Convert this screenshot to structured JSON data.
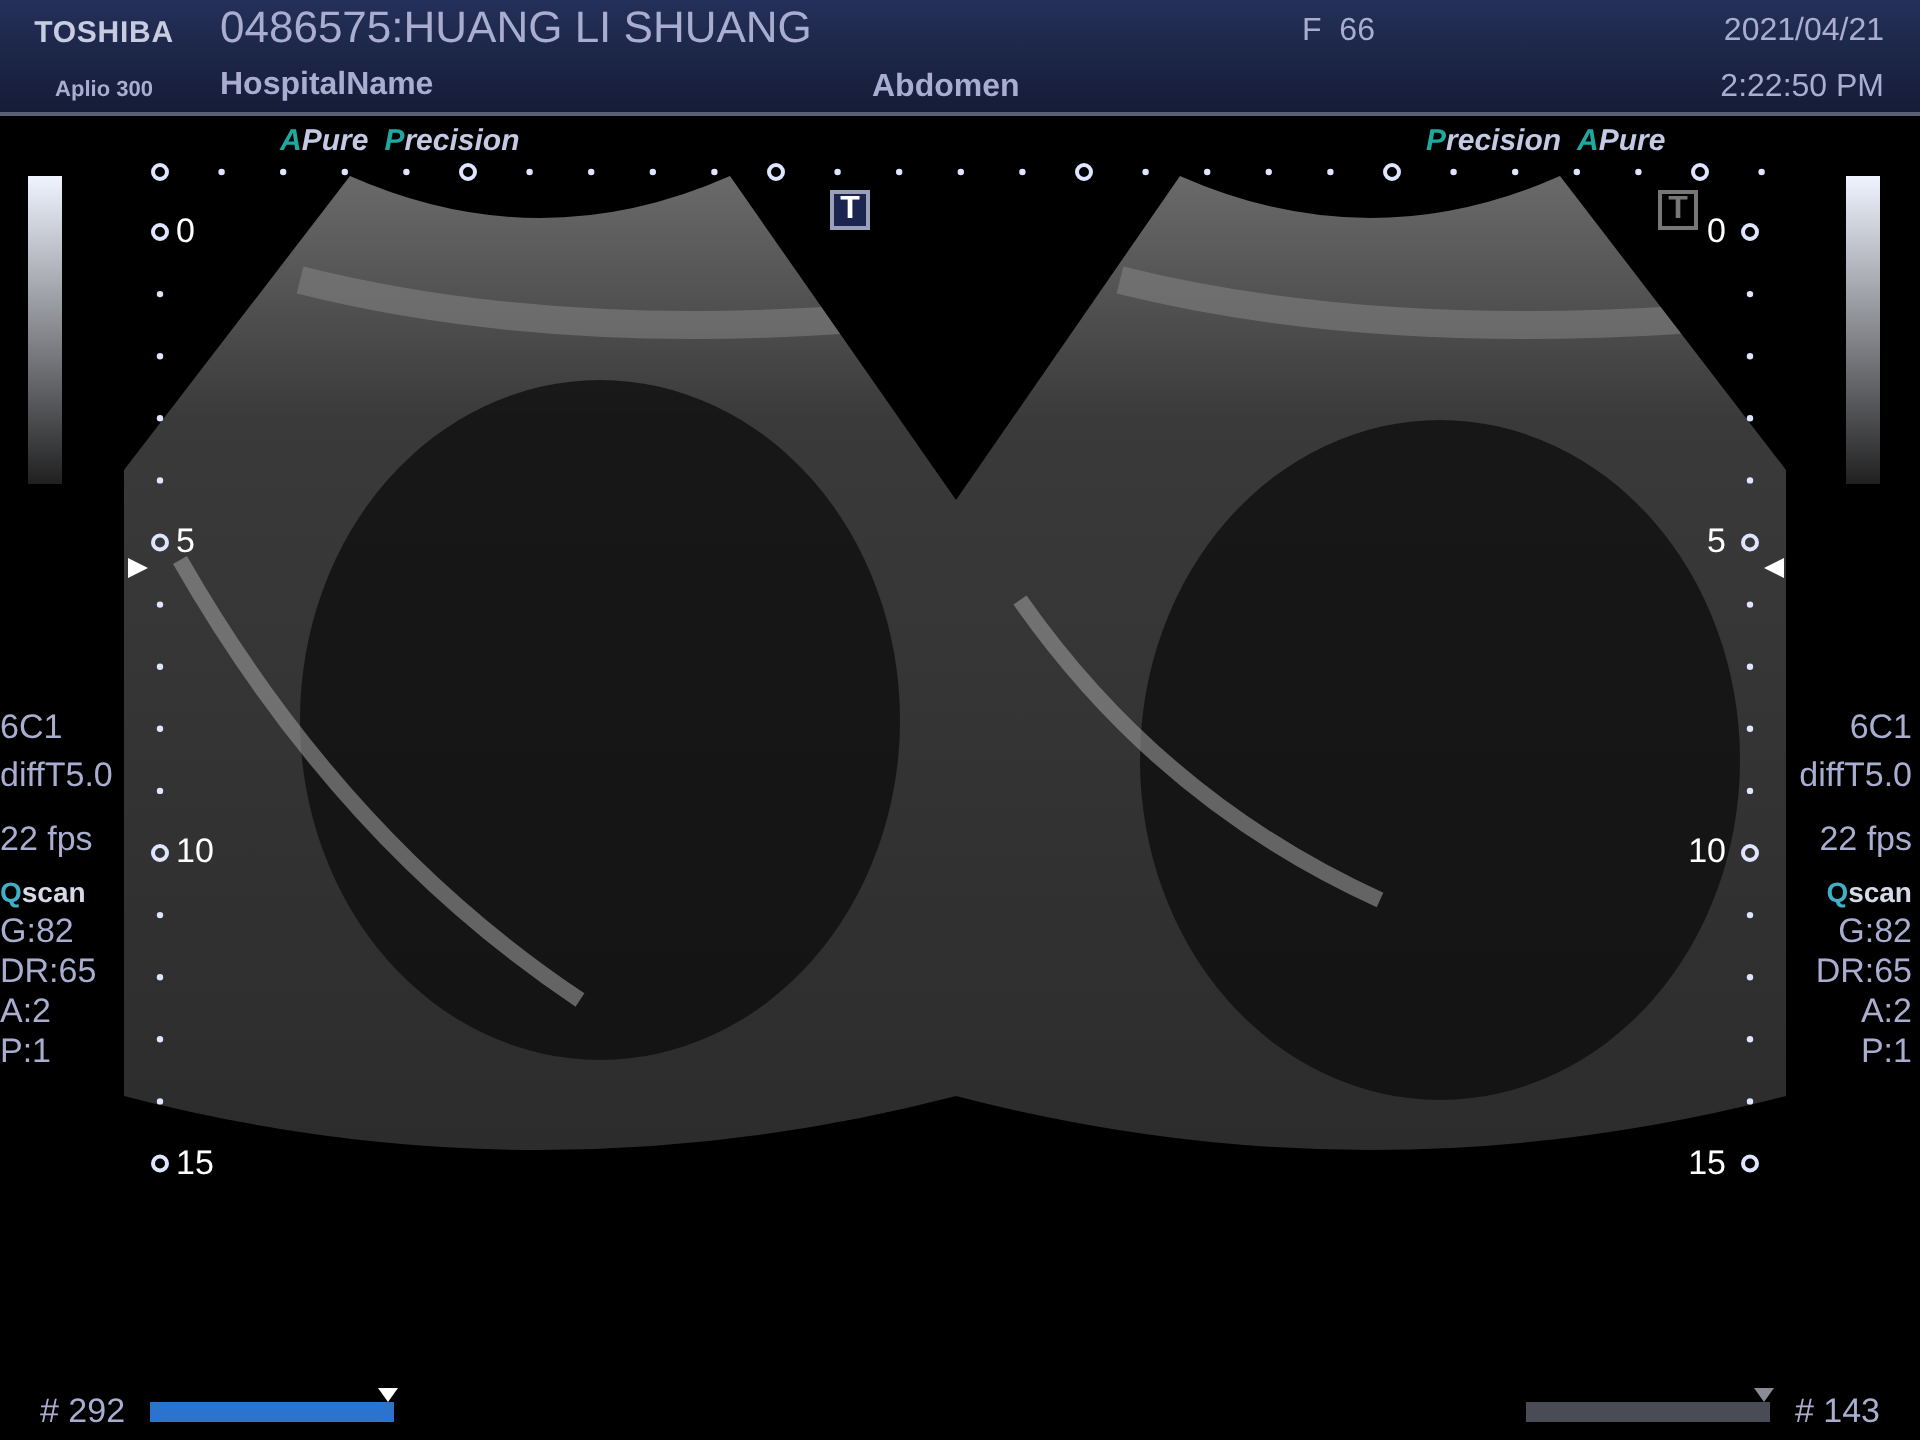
{
  "header": {
    "brand": "TOSHIBA",
    "model": "Aplio 300",
    "patient": "0486575:HUANG LI SHUANG",
    "hospital": "HospitalName",
    "sex_age": "F  66",
    "exam": "Abdomen",
    "date": "2021/04/21",
    "time": "2:22:50 PM"
  },
  "views": [
    {
      "badges": [
        {
          "accent": "A",
          "rest": "Pure"
        },
        {
          "accent": "P",
          "rest": "recision"
        }
      ],
      "t_marker": {
        "label": "T",
        "active": true
      },
      "depth_labels": [
        "0",
        "5",
        "10",
        "15"
      ],
      "info": [
        {
          "kind": "plain",
          "text": "6C1"
        },
        {
          "kind": "plain",
          "text": "diffT5.0"
        },
        {
          "kind": "plain",
          "text": "22 fps"
        },
        {
          "kind": "accent",
          "accent": "Q",
          "rest": "scan"
        },
        {
          "kind": "plain",
          "text": "G:82"
        },
        {
          "kind": "plain",
          "text": "DR:65"
        },
        {
          "kind": "plain",
          "text": "A:2"
        },
        {
          "kind": "plain",
          "text": "P:1"
        }
      ]
    },
    {
      "badges": [
        {
          "accent": "P",
          "rest": "recision"
        },
        {
          "accent": "A",
          "rest": "Pure"
        }
      ],
      "t_marker": {
        "label": "T",
        "active": false
      },
      "depth_labels": [
        "0",
        "5",
        "10",
        "15"
      ],
      "info": [
        {
          "kind": "plain",
          "text": "6C1"
        },
        {
          "kind": "plain",
          "text": "diffT5.0"
        },
        {
          "kind": "plain",
          "text": "22 fps"
        },
        {
          "kind": "accent",
          "accent": "Q",
          "rest": "scan"
        },
        {
          "kind": "plain",
          "text": "G:82"
        },
        {
          "kind": "plain",
          "text": "DR:65"
        },
        {
          "kind": "plain",
          "text": "A:2"
        },
        {
          "kind": "plain",
          "text": "P:1"
        }
      ]
    }
  ],
  "cine": [
    {
      "label": "# 292",
      "selected": true
    },
    {
      "label": "# 143",
      "selected": false
    }
  ]
}
